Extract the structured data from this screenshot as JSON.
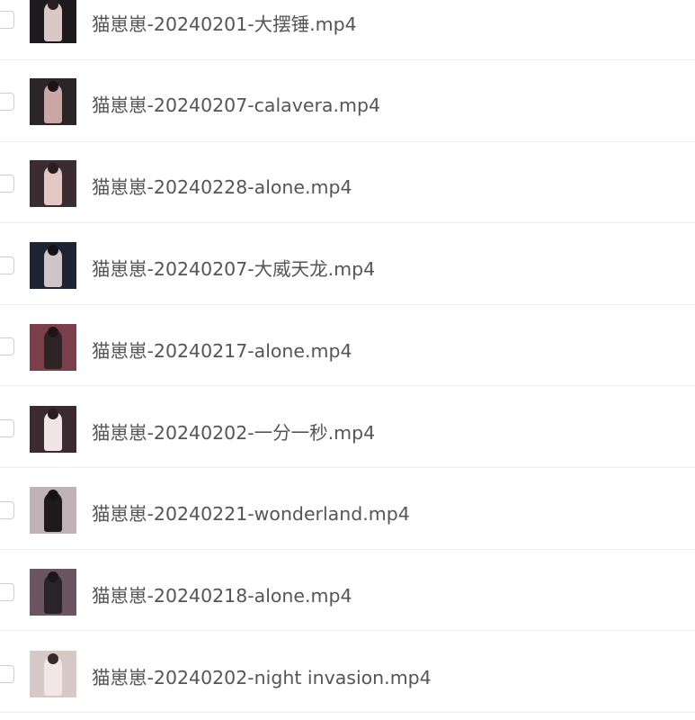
{
  "files": [
    {
      "name": "猫崽崽-20240201-大摆锤.mp4",
      "thumb": {
        "bg": "#1f1a1e",
        "figure": "#d9c8c6",
        "hair": "#2a2022"
      }
    },
    {
      "name": "猫崽崽-20240207-calavera.mp4",
      "thumb": {
        "bg": "#2b2528",
        "figure": "#c9a7a4",
        "hair": "#1a1416"
      }
    },
    {
      "name": "猫崽崽-20240228-alone.mp4",
      "thumb": {
        "bg": "#3a2c31",
        "figure": "#e2c8c4",
        "hair": "#2b1d1f"
      }
    },
    {
      "name": "猫崽崽-20240207-大威天龙.mp4",
      "thumb": {
        "bg": "#1e2433",
        "figure": "#cfc4c8",
        "hair": "#151216"
      }
    },
    {
      "name": "猫崽崽-20240217-alone.mp4",
      "thumb": {
        "bg": "#7a3f4a",
        "figure": "#2e2426",
        "hair": "#1d1517"
      }
    },
    {
      "name": "猫崽崽-20240202-一分一秒.mp4",
      "thumb": {
        "bg": "#3b2a30",
        "figure": "#f0e4e6",
        "hair": "#2a1d20"
      }
    },
    {
      "name": "猫崽崽-20240221-wonderland.mp4",
      "thumb": {
        "bg": "#bfb3b7",
        "figure": "#1e1a1c",
        "hair": "#171315"
      }
    },
    {
      "name": "猫崽崽-20240218-alone.mp4",
      "thumb": {
        "bg": "#6a5561",
        "figure": "#2a2327",
        "hair": "#1c1719"
      }
    },
    {
      "name": "猫崽崽-20240202-night invasion.mp4",
      "thumb": {
        "bg": "#d7c9c8",
        "figure": "#f2e6e6",
        "hair": "#3a2b2b"
      }
    }
  ]
}
